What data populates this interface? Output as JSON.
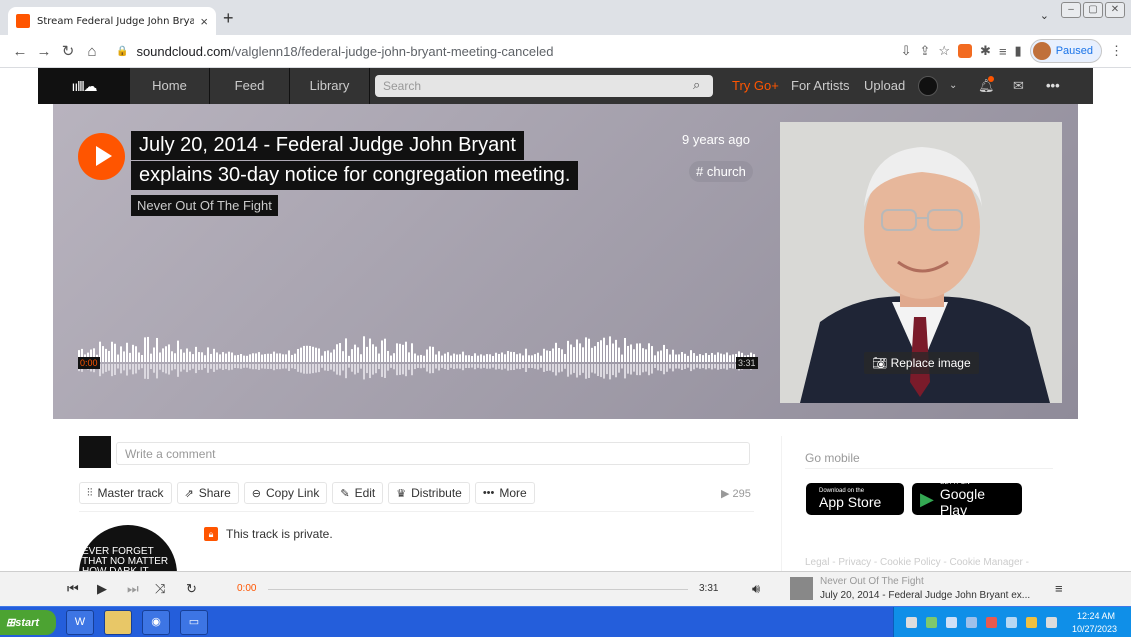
{
  "browser": {
    "tab_title": "Stream Federal Judge John Bryant - ",
    "tab_close": "×",
    "new_tab": "+",
    "url_domain": "soundcloud.com",
    "url_path": "/valglenn18/federal-judge-john-bryant-meeting-canceled",
    "profile_status": "Paused"
  },
  "sc_header": {
    "nav": [
      "Home",
      "Feed",
      "Library"
    ],
    "search_placeholder": "Search",
    "try_go": "Try Go+",
    "for_artists": "For Artists",
    "upload": "Upload"
  },
  "track": {
    "title_line1": "July 20, 2014 - Federal Judge John Bryant",
    "title_line2": "explains 30-day notice for congregation meeting.",
    "artist": "Never Out Of The Fight",
    "posted": "9 years ago",
    "tag": "# church",
    "time_start": "0:00",
    "time_end": "3:31",
    "replace_image": "Replace image"
  },
  "comment": {
    "placeholder": "Write a comment"
  },
  "actions": {
    "master_track": "Master track",
    "share": "Share",
    "copy_link": "Copy Link",
    "edit": "Edit",
    "distribute": "Distribute",
    "more": "More",
    "play_count": "295"
  },
  "private_note": "This track is private.",
  "artist_avatar_text": "EVER FORGET THAT NO MATTER HOW DARK IT GETS",
  "sidebar": {
    "go_mobile": "Go mobile",
    "app_store_small": "Download on the",
    "app_store_big": "App Store",
    "google_small": "GET IT ON",
    "google_big": "Google Play",
    "footer_links": "Legal - Privacy - Cookie Policy - Cookie Manager -"
  },
  "playbar": {
    "current_time": "0:00",
    "duration": "3:31",
    "artist": "Never Out Of The Fight",
    "title": "July 20, 2014 - Federal Judge John Bryant ex..."
  },
  "taskbar": {
    "start_label": "start",
    "clock_time": "12:24 AM",
    "clock_date": "10/27/2023"
  },
  "colors": {
    "accent": "#ff5500",
    "header_bg": "#333333",
    "taskbar_bg": "#245edb"
  }
}
